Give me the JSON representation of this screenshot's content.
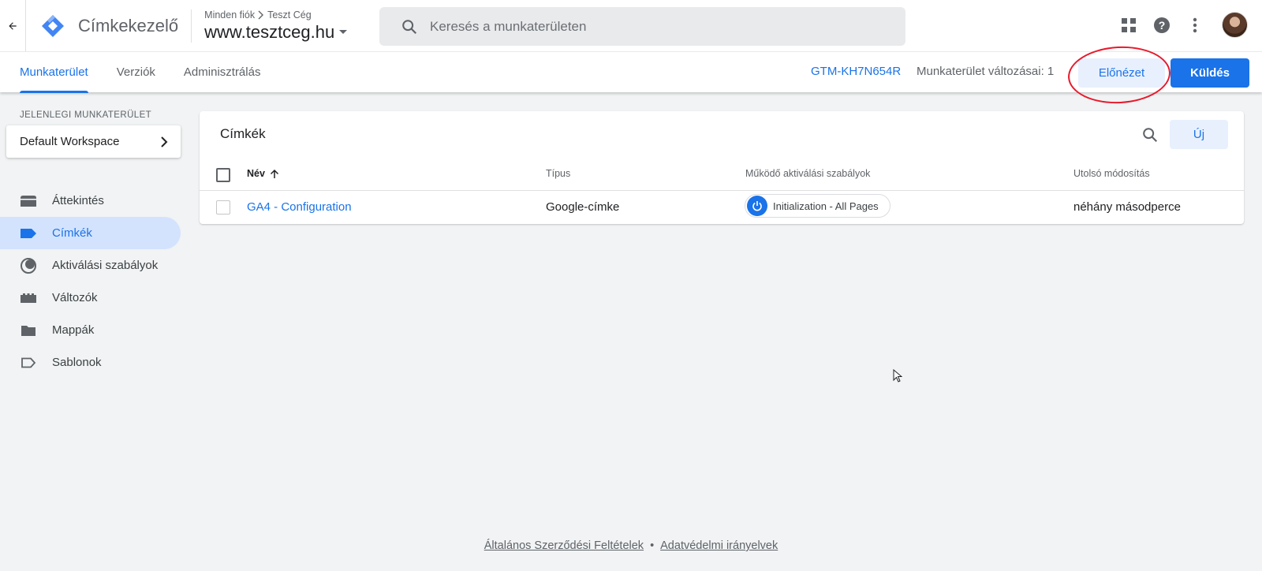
{
  "header": {
    "app_title": "Címkekezelő",
    "breadcrumb": [
      "Minden fiók",
      "Teszt Cég"
    ],
    "container_name": "www.tesztceg.hu",
    "search_placeholder": "Keresés a munkaterületen"
  },
  "subnav": {
    "tabs": [
      {
        "label": "Munkaterület",
        "active": true
      },
      {
        "label": "Verziók",
        "active": false
      },
      {
        "label": "Adminisztrálás",
        "active": false
      }
    ],
    "container_id": "GTM-KH7N654R",
    "workspace_changes": "Munkaterület változásai: 1",
    "preview_label": "Előnézet",
    "submit_label": "Küldés"
  },
  "sidebar": {
    "workspace_label": "JELENLEGI MUNKATERÜLET",
    "workspace_name": "Default Workspace",
    "items": [
      {
        "label": "Áttekintés",
        "icon": "overview-icon",
        "active": false
      },
      {
        "label": "Címkék",
        "icon": "tag-icon",
        "active": true
      },
      {
        "label": "Aktiválási szabályok",
        "icon": "trigger-icon",
        "active": false
      },
      {
        "label": "Változók",
        "icon": "variable-icon",
        "active": false
      },
      {
        "label": "Mappák",
        "icon": "folder-icon",
        "active": false
      },
      {
        "label": "Sablonok",
        "icon": "template-icon",
        "active": false
      }
    ]
  },
  "tags_table": {
    "title": "Címkék",
    "new_label": "Új",
    "columns": [
      "Név",
      "Típus",
      "Működő aktiválási szabályok",
      "Utolsó módosítás"
    ],
    "rows": [
      {
        "name": "GA4 - Configuration",
        "type": "Google-címke",
        "trigger": "Initialization - All Pages",
        "modified": "néhány másodperce"
      }
    ]
  },
  "footer": {
    "terms": "Általános Szerződési Feltételek",
    "separator": "•",
    "privacy": "Adatvédelmi irányelvek"
  },
  "colors": {
    "accent": "#1a73e8",
    "highlight": "#e8192c",
    "background": "#f1f3f4"
  }
}
